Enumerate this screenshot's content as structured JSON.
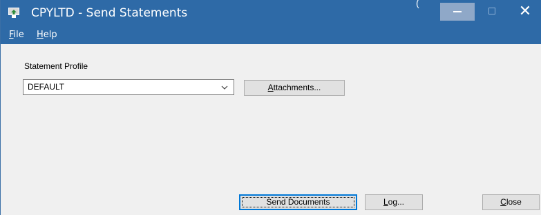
{
  "window": {
    "title": "CPYLTD - Send Statements",
    "stray_glyph": "("
  },
  "menu": {
    "file": {
      "accel": "F",
      "rest": "ile"
    },
    "help": {
      "accel": "H",
      "rest": "elp"
    }
  },
  "form": {
    "profile_label": "Statement Profile",
    "profile_value": "DEFAULT"
  },
  "buttons": {
    "attachments": {
      "accel": "A",
      "rest": "ttachments..."
    },
    "send_documents": "Send Documents",
    "log": {
      "accel": "L",
      "rest": "og..."
    },
    "close": {
      "accel": "C",
      "rest": "lose"
    }
  },
  "colors": {
    "titlebar": "#2e6aa7",
    "client": "#f0f0f0",
    "focus_border": "#0078d7"
  },
  "icons": [
    "app-icon",
    "minimize-icon",
    "maximize-icon",
    "close-icon",
    "chevron-down-icon"
  ]
}
